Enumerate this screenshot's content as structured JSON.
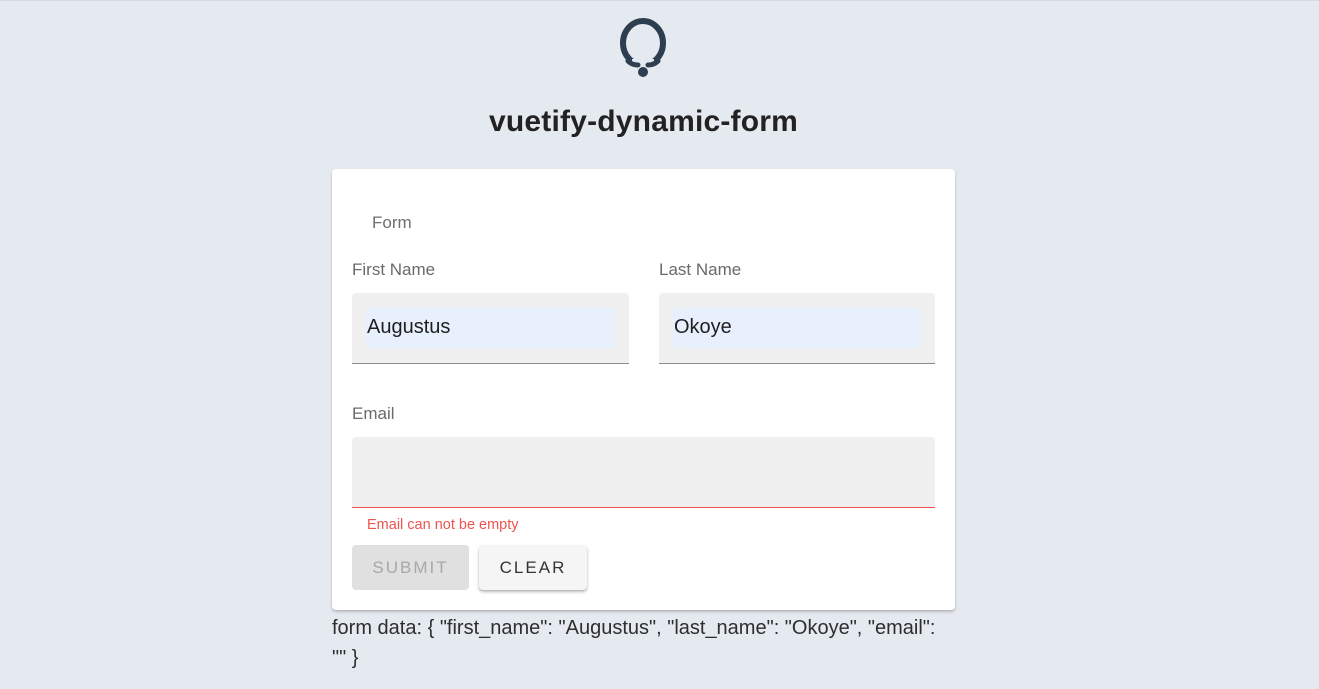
{
  "header": {
    "logo_icon": "logo-icon",
    "title": "vuetify-dynamic-form"
  },
  "form": {
    "legend": "Form",
    "fields": {
      "first_name": {
        "label": "First Name",
        "value": "Augustus"
      },
      "last_name": {
        "label": "Last Name",
        "value": "Okoye"
      },
      "email": {
        "label": "Email",
        "value": "",
        "error": "Email can not be empty"
      }
    },
    "buttons": {
      "submit": "Submit",
      "clear": "Clear"
    }
  },
  "output": {
    "form_data": "form data: { \"first_name\": \"Augustus\", \"last_name\": \"Okoye\", \"email\": \"\" }"
  },
  "colors": {
    "background": "#e5e9f0",
    "logo": "#2c3e50",
    "error": "#ef5350",
    "autofill": "#e8f0fe"
  }
}
